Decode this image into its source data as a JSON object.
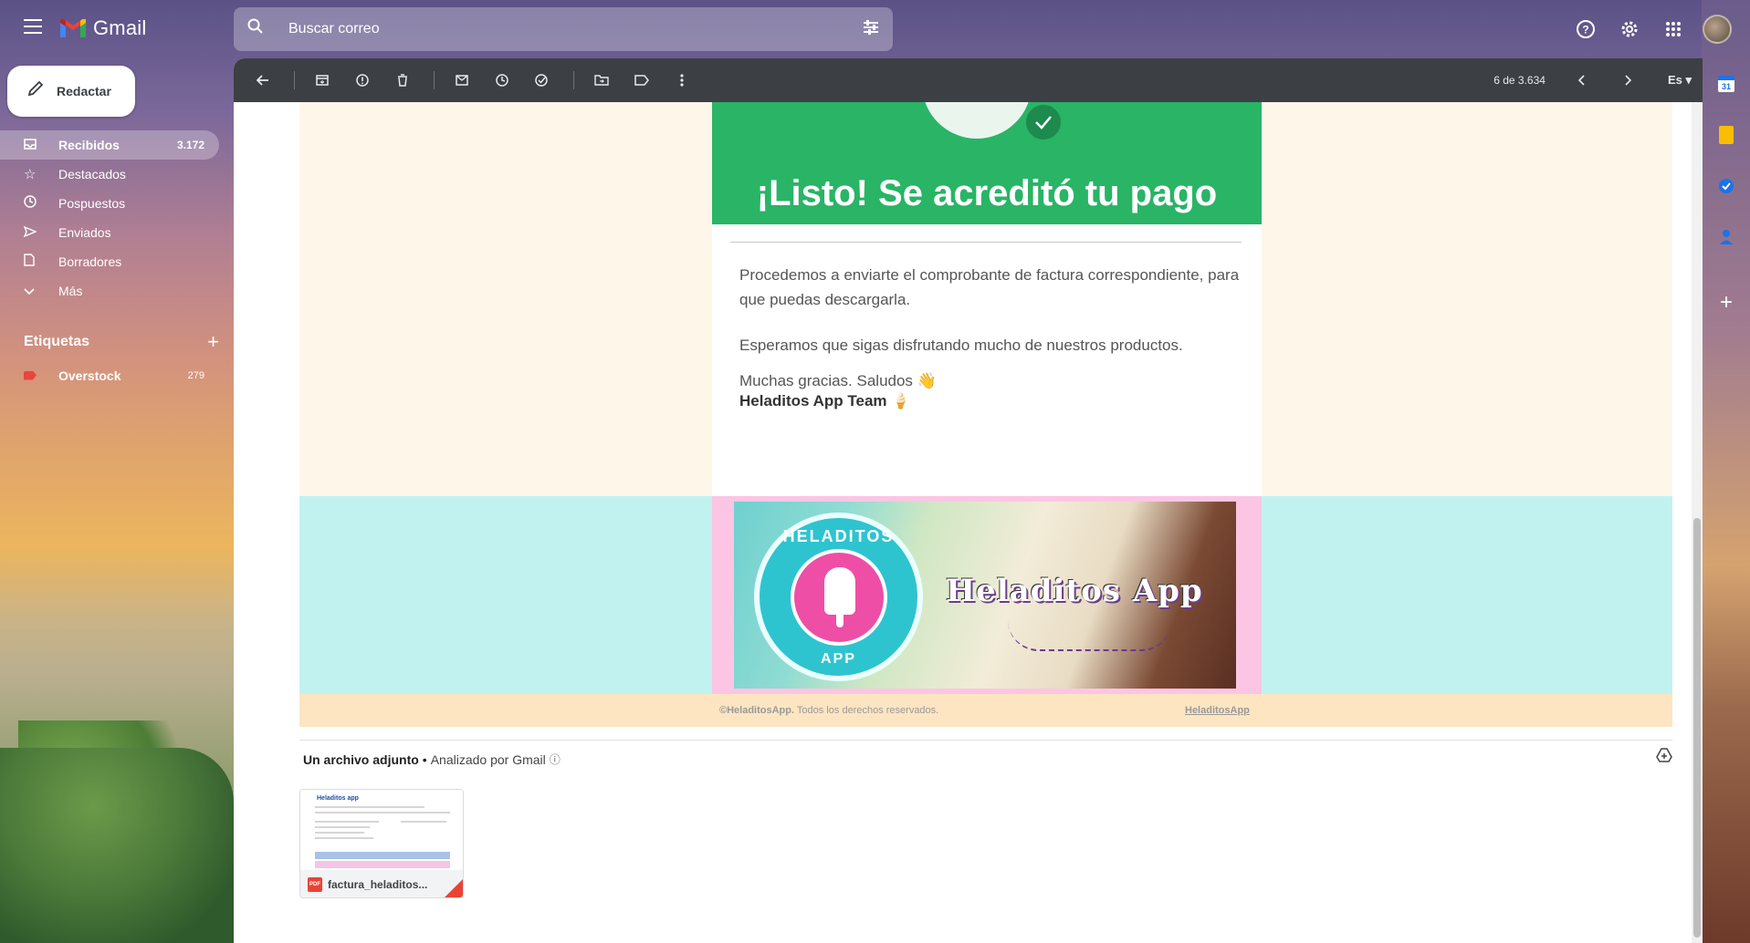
{
  "app": {
    "name": "Gmail"
  },
  "search": {
    "placeholder": "Buscar correo"
  },
  "compose": {
    "label": "Redactar"
  },
  "nav": {
    "items": [
      {
        "label": "Recibidos",
        "count": "3.172",
        "icon": "inbox-icon"
      },
      {
        "label": "Destacados",
        "count": "",
        "icon": "star-icon"
      },
      {
        "label": "Pospuestos",
        "count": "",
        "icon": "clock-icon"
      },
      {
        "label": "Enviados",
        "count": "",
        "icon": "send-icon"
      },
      {
        "label": "Borradores",
        "count": "",
        "icon": "draft-icon"
      },
      {
        "label": "Más",
        "count": "",
        "icon": "chevron-down-icon"
      }
    ]
  },
  "labels": {
    "header": "Etiquetas",
    "items": [
      {
        "label": "Overstock",
        "count": "279",
        "color": "#e8453c"
      }
    ]
  },
  "toolbar": {
    "pagination": "6 de 3.634",
    "language": "Es"
  },
  "email": {
    "hero_title": "¡Listo! Se acreditó tu pago",
    "para1": "Procedemos a enviarte el comprobante de factura correspondiente, para que puedas descargarla.",
    "para2": "Esperamos que sigas disfrutando mucho de nuestros productos.",
    "para3": "Muchas gracias. Saludos 👋",
    "signature": "Heladitos App Team 🍦",
    "banner": {
      "badge_top": "HELADITOS",
      "badge_bottom": "APP",
      "brand": "Heladitos App"
    },
    "footer_brand": "©HeladitosApp.",
    "footer_rights": "Todos los derechos reservados.",
    "footer_link": "HeladitosApp"
  },
  "attachments": {
    "title": "Un archivo adjunto",
    "scanned": "Analizado por Gmail",
    "items": [
      {
        "name": "factura_heladitos...",
        "type": "PDF",
        "thumb_heading": "Heladitos app"
      }
    ]
  },
  "colors": {
    "hero_green": "#29b466",
    "cream_band": "#fff6ea",
    "cyan_band": "#c2f2f0",
    "pink_frame": "#fcc5e4",
    "peach_band": "#fde5c2",
    "toolbar_dark": "#3c3f43"
  }
}
